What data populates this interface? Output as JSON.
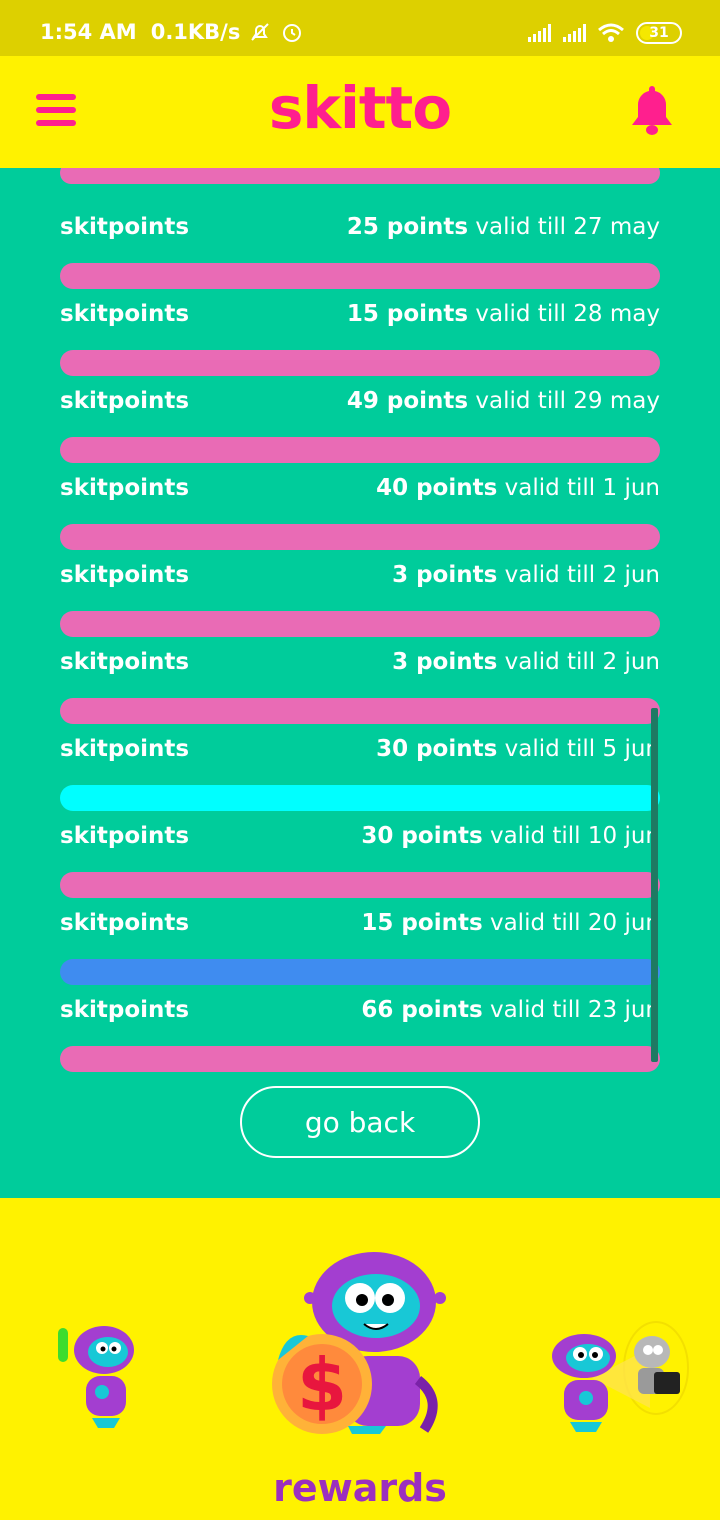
{
  "status": {
    "time": "1:54 AM",
    "speed": "0.1KB/s",
    "battery": "31"
  },
  "header": {
    "logo": "skitto"
  },
  "partial_bar_color": "#e96bb5",
  "points": [
    {
      "label": "skitpoints",
      "points": "25 points",
      "valid": "valid till 27 may",
      "color": "#e96bb5"
    },
    {
      "label": "skitpoints",
      "points": "15 points",
      "valid": "valid till 28 may",
      "color": "#e96bb5"
    },
    {
      "label": "skitpoints",
      "points": "49 points",
      "valid": "valid till 29 may",
      "color": "#e96bb5"
    },
    {
      "label": "skitpoints",
      "points": "40 points",
      "valid": "valid till 1 jun",
      "color": "#e96bb5"
    },
    {
      "label": "skitpoints",
      "points": "3 points",
      "valid": "valid till 2 jun",
      "color": "#e96bb5"
    },
    {
      "label": "skitpoints",
      "points": "3 points",
      "valid": "valid till 2 jun",
      "color": "#e96bb5"
    },
    {
      "label": "skitpoints",
      "points": "30 points",
      "valid": "valid till 5 jun",
      "color": "#00ffff"
    },
    {
      "label": "skitpoints",
      "points": "30 points",
      "valid": "valid till 10 jun",
      "color": "#e96bb5"
    },
    {
      "label": "skitpoints",
      "points": "15 points",
      "valid": "valid till 20 jun",
      "color": "#3f8cf0"
    },
    {
      "label": "skitpoints",
      "points": "66 points",
      "valid": "valid till 23 jun",
      "color": "#e96bb5"
    }
  ],
  "go_back_label": "go back",
  "bottom": {
    "label": "rewards"
  }
}
